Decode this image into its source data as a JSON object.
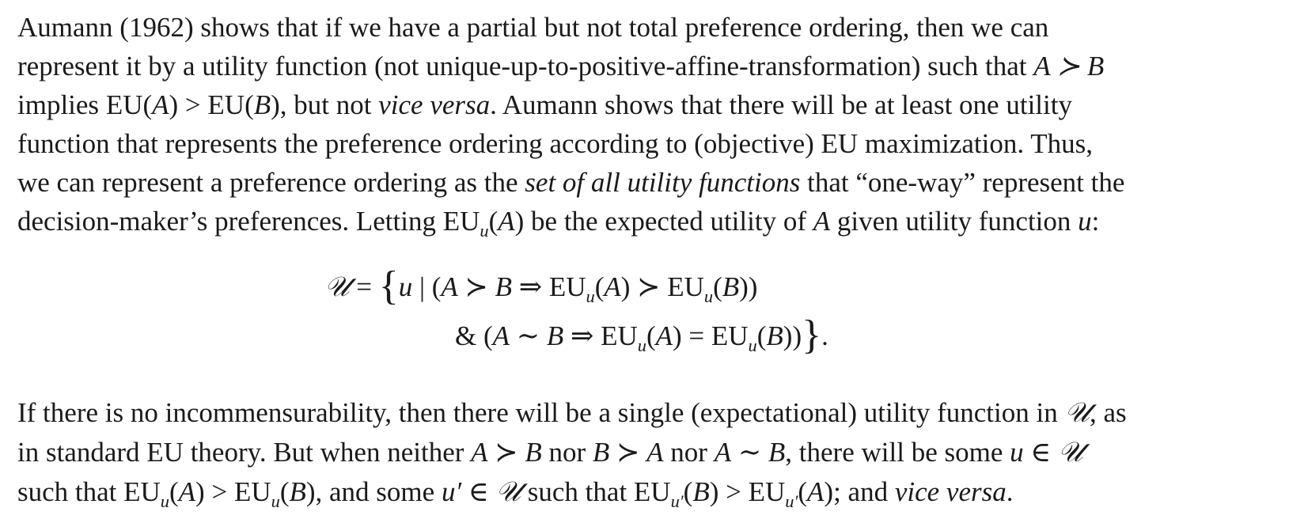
{
  "paragraph1": {
    "line1": "Aumann (1962) shows that if we have a partial but not total preference ordering, then we can",
    "line2_a": "represent it by a utility function (not unique-up-to-positive-affine-transformation) such that",
    "line2_math": "A ≻ B",
    "line3_math_a": "EU(A) > EU(B)",
    "line3_b": "implies",
    "line3_c": ", but not",
    "line3_vice": "vice versa",
    "line3_d": ". Aumann shows that there will be at least one utility",
    "line4": "function that represents the preference ordering according to (objective) EU maximization. Thus,",
    "line5_a": "we can represent a preference ordering as the",
    "line5_em": "set of all utility functions",
    "line5_b": "that “one-way” represent the",
    "line6_a": "decision-maker’s preferences. Letting",
    "line6_math": "EUu(A)",
    "line6_b": "be the expected utility of",
    "line6_c": "given utility function",
    "line6_end": ":"
  },
  "display_equation": {
    "line1": "𝒰 = {u | (A ≻ B ⇒ EUu(A) ≻ EUu(B))",
    "line2": "& (A ∼ B ⇒ EUu(A) = EUu(B))}."
  },
  "paragraph3": {
    "line1_a": "If there is no incommensurability, then there will be a single (expectational) utility function in",
    "line1_b": ", as",
    "line2_a": "in standard EU theory. But when neither",
    "line2_nor1": "nor",
    "line2_nor2": "nor",
    "line2_b": ", there will be some",
    "line3_a": "such that",
    "line3_b": ", and some",
    "line3_c": "such that",
    "line3_d": "; and",
    "line3_vice": "vice versa",
    "line3_end": "."
  }
}
